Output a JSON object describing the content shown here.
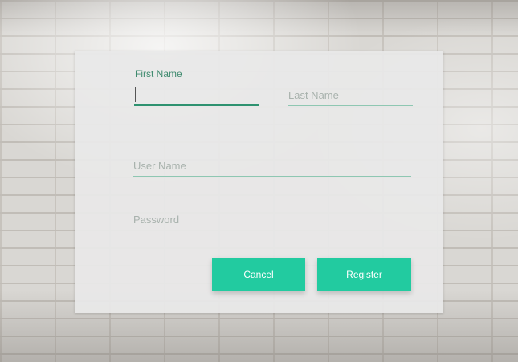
{
  "form": {
    "first_name": {
      "label": "First Name",
      "value": "",
      "placeholder": ""
    },
    "last_name": {
      "value": "",
      "placeholder": "Last Name"
    },
    "user_name": {
      "value": "",
      "placeholder": "User Name"
    },
    "password": {
      "value": "",
      "placeholder": "Password"
    }
  },
  "buttons": {
    "cancel_label": "Cancel",
    "register_label": "Register"
  },
  "colors": {
    "accent": "#22cba0",
    "label": "#3e8a6e",
    "underline_active": "#2e9270",
    "underline": "#8ec7b2",
    "card": "#e8e8e8"
  }
}
